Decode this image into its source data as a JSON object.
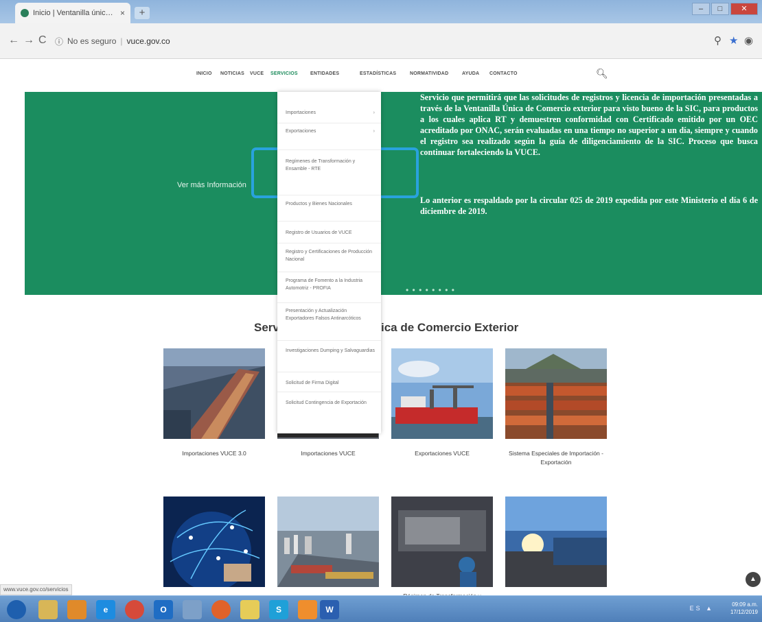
{
  "browser": {
    "tab_title": "Inicio | Ventanilla única de com",
    "tab_close": "×",
    "new_tab": "+",
    "back": "←",
    "forward": "→",
    "reload": "C",
    "security_text": "No es seguro",
    "url": "vuce.gov.co"
  },
  "site_nav": {
    "items": [
      "INICIO",
      "NOTICIAS",
      "VUCE",
      "SERVICIOS",
      "ENTIDADES",
      "ESTADÍSTICAS",
      "NORMATIVIDAD",
      "AYUDA",
      "CONTACTO"
    ],
    "active": "SERVICIOS"
  },
  "hero": {
    "more_link": "Ver más Información",
    "para1": "Servicio que permitirá que las solicitudes de registros y licencia de importación presentadas a través de la Ventanilla Única de Comercio exterior para visto bueno de la SIC, para productos a los cuales aplica RT y demuestren conformidad con Certificado emitido por un OEC acreditado por ONAC, serán evaluadas en una tiempo no superior a un día, siempre y cuando el registro sea realizado según la guía de diligenciamiento de la SIC. Proceso que busca continuar fortaleciendo la VUCE.",
    "para2": "Lo anterior es respaldado por la circular 025 de 2019 expedida por este Ministerio el día 6 de diciembre de 2019."
  },
  "dropdown": {
    "items": [
      {
        "label": "Importaciones",
        "chevron": "›"
      },
      {
        "label": "Exportaciones",
        "chevron": "›"
      },
      {
        "label": "Regímenes de Transformación y Ensamble - RTE",
        "chevron": ""
      },
      {
        "label": "Productos y Bienes Nacionales",
        "chevron": ""
      },
      {
        "label": "Registro de Usuarios de VUCE",
        "chevron": ""
      },
      {
        "label": "Registro y Certificaciones de Producción Nacional",
        "chevron": ""
      },
      {
        "label": "Programa de Fomento a la Industria Automotriz - PROFIA",
        "chevron": ""
      },
      {
        "label": "Presentación y Actualización Exportadores Falsos Antinarcóticos",
        "chevron": ""
      },
      {
        "label": "Investigaciones Dumping y Salvaguardias",
        "chevron": ""
      },
      {
        "label": "Solicitud de Firma Digital",
        "chevron": ""
      },
      {
        "label": "Solicitud Contingencia de Exportación",
        "chevron": ""
      }
    ]
  },
  "services": {
    "title_left": "Serv",
    "title_right": "ica de Comercio Exterior",
    "cards": [
      {
        "label": "Importaciones VUCE 3.0"
      },
      {
        "label": "Importaciones VUCE"
      },
      {
        "label": "Exportaciones VUCE"
      },
      {
        "label": "Sistema Especiales de Importación - Exportación"
      },
      {
        "label": ""
      },
      {
        "label": ""
      },
      {
        "label": "Régimen de Transformación y"
      },
      {
        "label": ""
      }
    ]
  },
  "status_bar": "www.vuce.gov.co/servicios",
  "taskbar": {
    "icons": [
      "",
      "",
      "",
      "e",
      "",
      "O",
      "",
      "",
      "",
      "S",
      "",
      "W"
    ],
    "tray": "ES ▲",
    "clock_time": "09:09 a.m.",
    "clock_date": "17/12/2019"
  },
  "colors": {
    "brand_green": "#1b8d5f",
    "highlight_blue": "#29a2dd"
  }
}
